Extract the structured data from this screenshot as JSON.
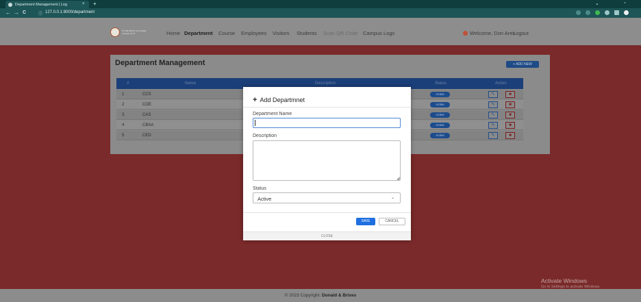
{
  "browser": {
    "tab_title": "Department Management | Log",
    "tab_close": "×",
    "new_tab": "+",
    "url": "127.0.0.1:8000/department",
    "back": "←",
    "forward": "→",
    "reload": "C"
  },
  "navbar": {
    "logo_text": "ST.PETER'S COLLEGE ILIGAN CITY",
    "links": [
      "Home",
      "Department",
      "Course",
      "Employees",
      "Visitors",
      "Students",
      "Scan QR Code",
      "Campus Logs"
    ],
    "active_link": "Department",
    "welcome": "Welcome, Don Ares",
    "logout": "Logout"
  },
  "page": {
    "title": "Department Management",
    "add_new_label": "+ ADD NEW",
    "columns": [
      "#",
      "Name",
      "Description",
      "Status",
      "Action"
    ],
    "rows": [
      {
        "num": "1",
        "name": "CCS",
        "status": "Active"
      },
      {
        "num": "2",
        "name": "COE",
        "status": "Active"
      },
      {
        "num": "3",
        "name": "CAS",
        "status": "Active"
      },
      {
        "num": "4",
        "name": "CBAA",
        "status": "Active"
      },
      {
        "num": "5",
        "name": "CED",
        "status": "Active"
      }
    ]
  },
  "modal": {
    "title": "Add Departmnet",
    "plus": "+",
    "department_name_label": "Department Name",
    "department_name_value": "",
    "description_label": "Description",
    "description_value": "",
    "status_label": "Status",
    "status_value": "Active",
    "save_label": "SAVE",
    "cancel_label": "CANCEL",
    "close_label": "CLOSE"
  },
  "footer": {
    "copyright": "© 2023 Copyright:",
    "owner": "Donald & Brixes"
  },
  "os_overlay": {
    "activate_title": "Activate Windows",
    "activate_sub": "Go to Settings to activate Windows."
  },
  "colors": {
    "page_bg": "#7a2a2a",
    "primary": "#1f6fe0",
    "table_header": "#1b3f78",
    "browser_chrome": "#0f3d3e"
  }
}
